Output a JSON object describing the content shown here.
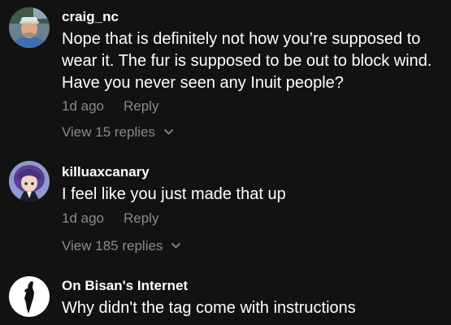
{
  "comments": [
    {
      "username": "craig_nc",
      "avatar_icon": "man-with-cap-avatar",
      "lines": [
        "Nope that is definitely not how you’re supposed to",
        "wear it. The fur is supposed to be out to block wind.",
        "Have you never seen any Inuit people?"
      ],
      "time": "1d ago",
      "reply_label": "Reply",
      "view_replies": "View 15 replies"
    },
    {
      "username": "killuaxcanary",
      "avatar_icon": "anime-character-avatar",
      "lines": [
        "I feel like you just made that up"
      ],
      "time": "1d ago",
      "reply_label": "Reply",
      "view_replies": "View 185 replies"
    },
    {
      "username": "On Bisan's Internet",
      "avatar_icon": "map-silhouette-avatar",
      "lines": [
        "Why didn't the tag come with instructions"
      ]
    }
  ],
  "colors": {
    "background": "#121212",
    "primary_text": "#ffffff",
    "secondary_text": "#8a8a8a"
  }
}
